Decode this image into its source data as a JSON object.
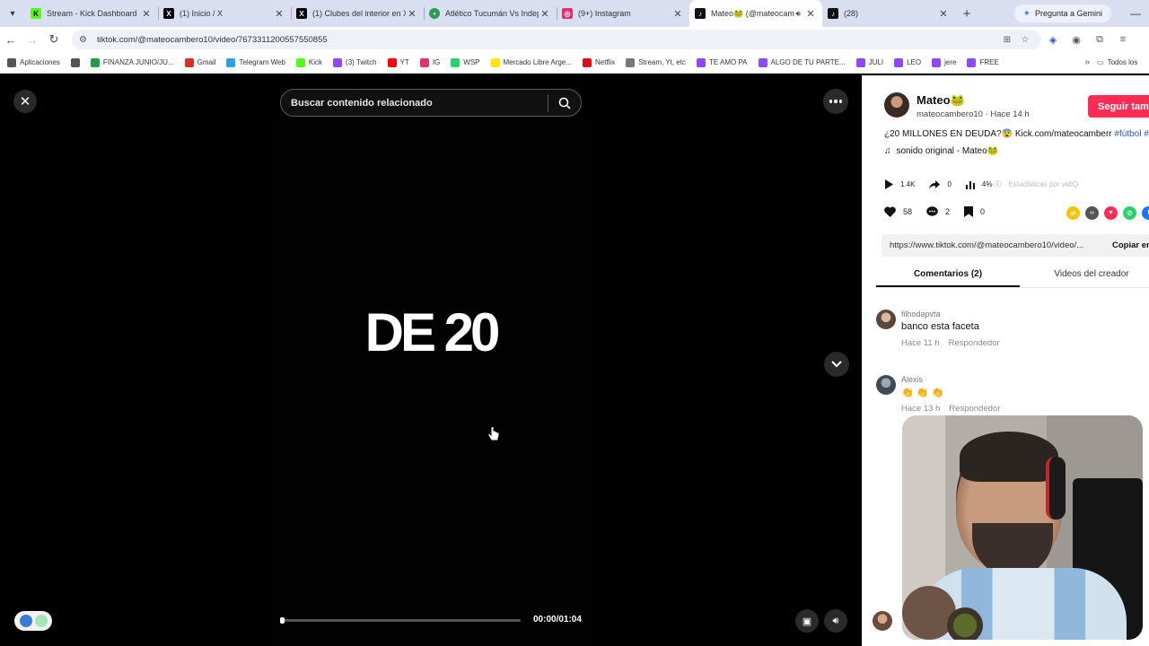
{
  "browser": {
    "tabs": [
      {
        "title": "Stream - Kick Dashboard",
        "favicon": "K",
        "favicon_color": "#53fc18",
        "active": false
      },
      {
        "title": "(1) Inicio / X",
        "favicon": "X",
        "favicon_color": "#000000",
        "active": false
      },
      {
        "title": "(1) Clubes del interior en X",
        "favicon": "X",
        "favicon_color": "#000000",
        "active": false
      },
      {
        "title": "Atlético Tucumán Vs Indep",
        "favicon": "⚽",
        "favicon_color": "#2e9d4e",
        "active": false
      },
      {
        "title": "(9+) Instagram",
        "favicon": "◎",
        "favicon_color": "#e1306c",
        "active": false
      },
      {
        "title": "Mateo🐸 (@mateocam",
        "favicon": "♪",
        "favicon_color": "#111111",
        "active": true
      },
      {
        "title": "(28)",
        "favicon": "♪",
        "favicon_color": "#111111",
        "active": false
      }
    ],
    "gemini_label": "Pregunta a Gemini",
    "url": "tiktok.com/@mateocambero10/video/7673311200557550855",
    "bookmarks": [
      {
        "label": "Aplicaciones",
        "color": "#555555"
      },
      {
        "label": "",
        "color": "#555555"
      },
      {
        "label": "FINANZA JUNIO/JU...",
        "color": "#1e9e4a"
      },
      {
        "label": "Gmail",
        "color": "#d93025"
      },
      {
        "label": "Telegram Web",
        "color": "#2aa3df"
      },
      {
        "label": "Kick",
        "color": "#53fc18"
      },
      {
        "label": "(3) Twitch",
        "color": "#9146ff"
      },
      {
        "label": "YT",
        "color": "#ff0000"
      },
      {
        "label": "IG",
        "color": "#e1306c"
      },
      {
        "label": "WSP",
        "color": "#25d366"
      },
      {
        "label": "Mercado Libre Arge...",
        "color": "#ffe600"
      },
      {
        "label": "Netflix",
        "color": "#e50914"
      },
      {
        "label": "Stream, Yt, etc",
        "color": "#777777"
      },
      {
        "label": "TE AMO PA",
        "color": "#9146ff"
      },
      {
        "label": "ALGO DE TU PARTE...",
        "color": "#9146ff"
      },
      {
        "label": "JULI",
        "color": "#9146ff"
      },
      {
        "label": "LEO",
        "color": "#9146ff"
      },
      {
        "label": "jere",
        "color": "#9146ff"
      },
      {
        "label": "FREE",
        "color": "#9146ff"
      }
    ],
    "all_bookmarks": "Todos los"
  },
  "video": {
    "search_placeholder": "Buscar contenido relacionado",
    "overlay_text": "DE 20",
    "time": "00:00/01:04",
    "progress": 0.01
  },
  "panel": {
    "author_name": "Mateo🐸",
    "author_meta": "mateocambero10 · Hace 14 h",
    "follow_label": "Seguir también",
    "description": "¿20 MILLONES EN DEUDA?😨 Kick.com/mateocamberr ",
    "hashtags": "#fútbol #",
    "sound": "sonido original - Mateo🐸",
    "plays": "1.4K",
    "shares": "0",
    "engagement": "4%",
    "stats_label": "Estadísticas por vidIQ",
    "likes": "58",
    "comments": "2",
    "saves": "0",
    "link": "https://www.tiktok.com/@mateocambero10/video/...",
    "copy_label": "Copiar enlace",
    "tab_comments": "Comentarios (2)",
    "tab_creator": "Videos del creador",
    "comment_list": [
      {
        "user": "filhodapvta",
        "text": "banco esta faceta",
        "time": "Hace 11 h",
        "reply": "Respondedor"
      },
      {
        "user": "Alexis",
        "text": "👏 👏 👏",
        "time": "Hace 13 h",
        "reply": "Respondedor"
      }
    ]
  }
}
